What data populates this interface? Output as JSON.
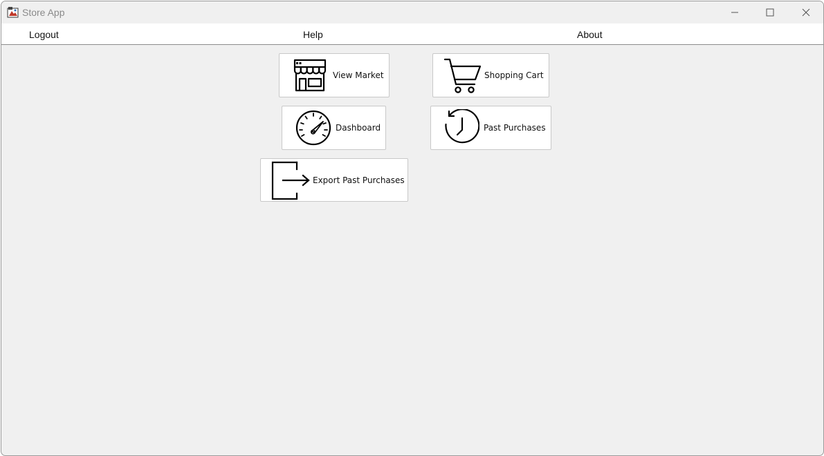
{
  "window": {
    "title": "Store App",
    "app_icon": "java-app-icon",
    "controls": [
      "minimize-icon",
      "maximize-icon",
      "close-icon"
    ]
  },
  "menu": {
    "logout": "Logout",
    "help": "Help",
    "about": "About"
  },
  "tiles": {
    "view_market": {
      "label": "View Market",
      "icon": "storefront-icon"
    },
    "shopping_cart": {
      "label": "Shopping Cart",
      "icon": "shopping-cart-icon"
    },
    "dashboard": {
      "label": "Dashboard",
      "icon": "speedometer-icon"
    },
    "past_purchases": {
      "label": "Past Purchases",
      "icon": "history-clock-icon"
    },
    "export_past_purchases": {
      "label": "Export Past Purchases",
      "icon": "export-arrow-icon"
    }
  }
}
